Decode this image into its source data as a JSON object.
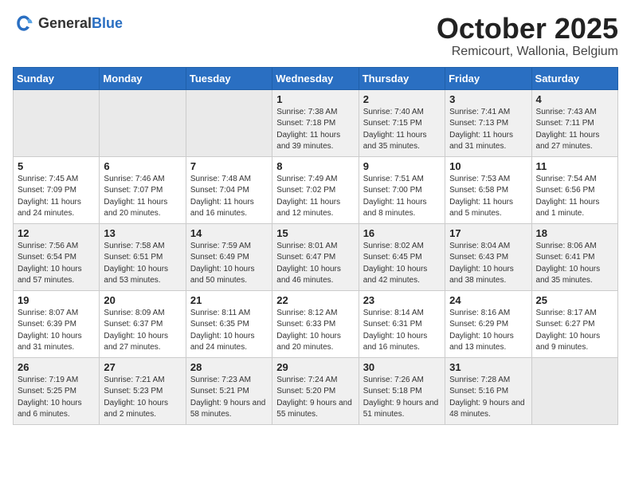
{
  "header": {
    "logo_general": "General",
    "logo_blue": "Blue",
    "month": "October 2025",
    "location": "Remicourt, Wallonia, Belgium"
  },
  "weekdays": [
    "Sunday",
    "Monday",
    "Tuesday",
    "Wednesday",
    "Thursday",
    "Friday",
    "Saturday"
  ],
  "weeks": [
    [
      {
        "day": "",
        "sunrise": "",
        "sunset": "",
        "daylight": "",
        "empty": true
      },
      {
        "day": "",
        "sunrise": "",
        "sunset": "",
        "daylight": "",
        "empty": true
      },
      {
        "day": "",
        "sunrise": "",
        "sunset": "",
        "daylight": "",
        "empty": true
      },
      {
        "day": "1",
        "sunrise": "Sunrise: 7:38 AM",
        "sunset": "Sunset: 7:18 PM",
        "daylight": "Daylight: 11 hours and 39 minutes."
      },
      {
        "day": "2",
        "sunrise": "Sunrise: 7:40 AM",
        "sunset": "Sunset: 7:15 PM",
        "daylight": "Daylight: 11 hours and 35 minutes."
      },
      {
        "day": "3",
        "sunrise": "Sunrise: 7:41 AM",
        "sunset": "Sunset: 7:13 PM",
        "daylight": "Daylight: 11 hours and 31 minutes."
      },
      {
        "day": "4",
        "sunrise": "Sunrise: 7:43 AM",
        "sunset": "Sunset: 7:11 PM",
        "daylight": "Daylight: 11 hours and 27 minutes."
      }
    ],
    [
      {
        "day": "5",
        "sunrise": "Sunrise: 7:45 AM",
        "sunset": "Sunset: 7:09 PM",
        "daylight": "Daylight: 11 hours and 24 minutes."
      },
      {
        "day": "6",
        "sunrise": "Sunrise: 7:46 AM",
        "sunset": "Sunset: 7:07 PM",
        "daylight": "Daylight: 11 hours and 20 minutes."
      },
      {
        "day": "7",
        "sunrise": "Sunrise: 7:48 AM",
        "sunset": "Sunset: 7:04 PM",
        "daylight": "Daylight: 11 hours and 16 minutes."
      },
      {
        "day": "8",
        "sunrise": "Sunrise: 7:49 AM",
        "sunset": "Sunset: 7:02 PM",
        "daylight": "Daylight: 11 hours and 12 minutes."
      },
      {
        "day": "9",
        "sunrise": "Sunrise: 7:51 AM",
        "sunset": "Sunset: 7:00 PM",
        "daylight": "Daylight: 11 hours and 8 minutes."
      },
      {
        "day": "10",
        "sunrise": "Sunrise: 7:53 AM",
        "sunset": "Sunset: 6:58 PM",
        "daylight": "Daylight: 11 hours and 5 minutes."
      },
      {
        "day": "11",
        "sunrise": "Sunrise: 7:54 AM",
        "sunset": "Sunset: 6:56 PM",
        "daylight": "Daylight: 11 hours and 1 minute."
      }
    ],
    [
      {
        "day": "12",
        "sunrise": "Sunrise: 7:56 AM",
        "sunset": "Sunset: 6:54 PM",
        "daylight": "Daylight: 10 hours and 57 minutes."
      },
      {
        "day": "13",
        "sunrise": "Sunrise: 7:58 AM",
        "sunset": "Sunset: 6:51 PM",
        "daylight": "Daylight: 10 hours and 53 minutes."
      },
      {
        "day": "14",
        "sunrise": "Sunrise: 7:59 AM",
        "sunset": "Sunset: 6:49 PM",
        "daylight": "Daylight: 10 hours and 50 minutes."
      },
      {
        "day": "15",
        "sunrise": "Sunrise: 8:01 AM",
        "sunset": "Sunset: 6:47 PM",
        "daylight": "Daylight: 10 hours and 46 minutes."
      },
      {
        "day": "16",
        "sunrise": "Sunrise: 8:02 AM",
        "sunset": "Sunset: 6:45 PM",
        "daylight": "Daylight: 10 hours and 42 minutes."
      },
      {
        "day": "17",
        "sunrise": "Sunrise: 8:04 AM",
        "sunset": "Sunset: 6:43 PM",
        "daylight": "Daylight: 10 hours and 38 minutes."
      },
      {
        "day": "18",
        "sunrise": "Sunrise: 8:06 AM",
        "sunset": "Sunset: 6:41 PM",
        "daylight": "Daylight: 10 hours and 35 minutes."
      }
    ],
    [
      {
        "day": "19",
        "sunrise": "Sunrise: 8:07 AM",
        "sunset": "Sunset: 6:39 PM",
        "daylight": "Daylight: 10 hours and 31 minutes."
      },
      {
        "day": "20",
        "sunrise": "Sunrise: 8:09 AM",
        "sunset": "Sunset: 6:37 PM",
        "daylight": "Daylight: 10 hours and 27 minutes."
      },
      {
        "day": "21",
        "sunrise": "Sunrise: 8:11 AM",
        "sunset": "Sunset: 6:35 PM",
        "daylight": "Daylight: 10 hours and 24 minutes."
      },
      {
        "day": "22",
        "sunrise": "Sunrise: 8:12 AM",
        "sunset": "Sunset: 6:33 PM",
        "daylight": "Daylight: 10 hours and 20 minutes."
      },
      {
        "day": "23",
        "sunrise": "Sunrise: 8:14 AM",
        "sunset": "Sunset: 6:31 PM",
        "daylight": "Daylight: 10 hours and 16 minutes."
      },
      {
        "day": "24",
        "sunrise": "Sunrise: 8:16 AM",
        "sunset": "Sunset: 6:29 PM",
        "daylight": "Daylight: 10 hours and 13 minutes."
      },
      {
        "day": "25",
        "sunrise": "Sunrise: 8:17 AM",
        "sunset": "Sunset: 6:27 PM",
        "daylight": "Daylight: 10 hours and 9 minutes."
      }
    ],
    [
      {
        "day": "26",
        "sunrise": "Sunrise: 7:19 AM",
        "sunset": "Sunset: 5:25 PM",
        "daylight": "Daylight: 10 hours and 6 minutes."
      },
      {
        "day": "27",
        "sunrise": "Sunrise: 7:21 AM",
        "sunset": "Sunset: 5:23 PM",
        "daylight": "Daylight: 10 hours and 2 minutes."
      },
      {
        "day": "28",
        "sunrise": "Sunrise: 7:23 AM",
        "sunset": "Sunset: 5:21 PM",
        "daylight": "Daylight: 9 hours and 58 minutes."
      },
      {
        "day": "29",
        "sunrise": "Sunrise: 7:24 AM",
        "sunset": "Sunset: 5:20 PM",
        "daylight": "Daylight: 9 hours and 55 minutes."
      },
      {
        "day": "30",
        "sunrise": "Sunrise: 7:26 AM",
        "sunset": "Sunset: 5:18 PM",
        "daylight": "Daylight: 9 hours and 51 minutes."
      },
      {
        "day": "31",
        "sunrise": "Sunrise: 7:28 AM",
        "sunset": "Sunset: 5:16 PM",
        "daylight": "Daylight: 9 hours and 48 minutes."
      },
      {
        "day": "",
        "sunrise": "",
        "sunset": "",
        "daylight": "",
        "empty": true
      }
    ]
  ]
}
